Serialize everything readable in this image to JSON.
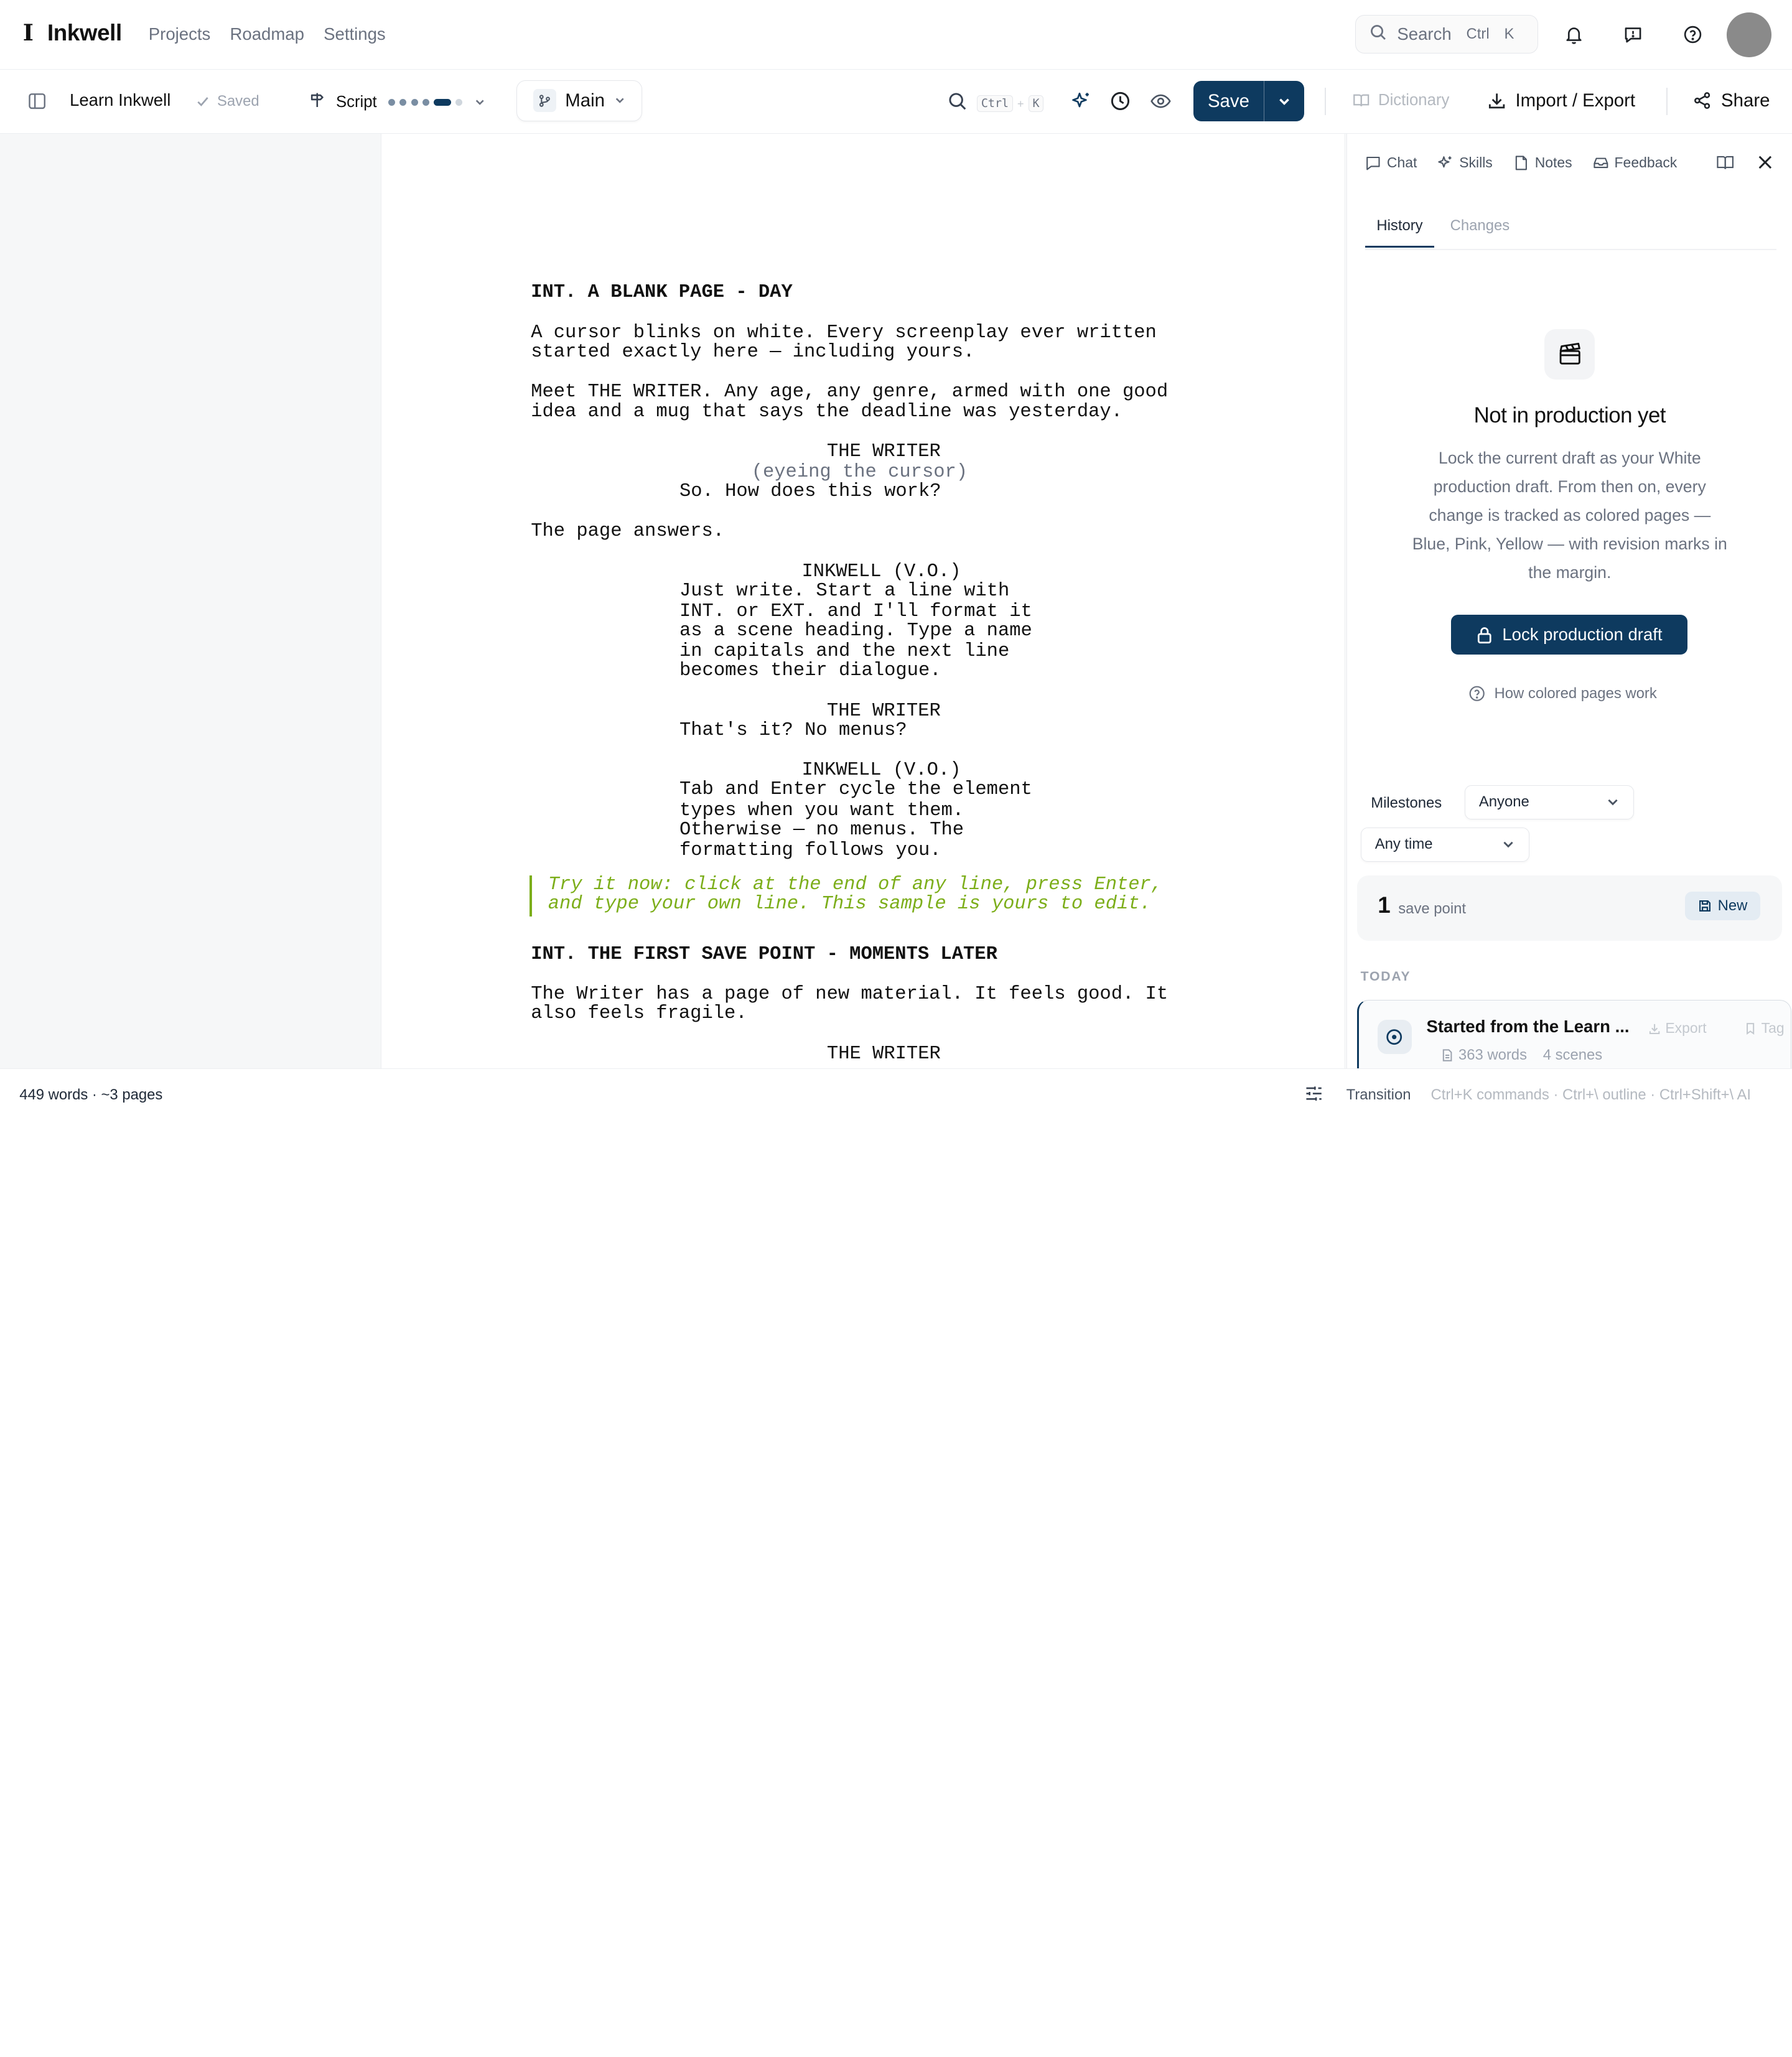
{
  "app": {
    "logo_mark": "I",
    "name": "Inkwell",
    "nav": [
      "Projects",
      "Roadmap",
      "Settings"
    ],
    "search": {
      "label": "Search",
      "shortcut_mod": "Ctrl",
      "shortcut_key": "K"
    }
  },
  "toolbar": {
    "doc_title": "Learn Inkwell",
    "saved_status": "Saved",
    "mode": "Script",
    "branch": "Main",
    "find_kbd_mod": "Ctrl",
    "find_kbd_plus": "+",
    "find_kbd_key": "K",
    "save": "Save",
    "dictionary": "Dictionary",
    "import_export": "Import / Export",
    "share": "Share"
  },
  "script": {
    "h1": "INT. A BLANK PAGE - DAY",
    "a1_l1": "A cursor blinks on white. Every screenplay ever written",
    "a1_l2": "started exactly here — including yours.",
    "a2_l1": "Meet THE WRITER. Any age, any genre, armed with one good",
    "a2_l2": "idea and a mug that says the deadline was yesterday.",
    "c1": "THE WRITER",
    "p1": "(eyeing the cursor)",
    "d1": "So. How does this work?",
    "a3": "The page answers.",
    "c2": "INKWELL (V.O.)",
    "d2_l1": "Just write. Start a line with",
    "d2_l2": "INT. or EXT. and I'll format it",
    "d2_l3": "as a scene heading. Type a name",
    "d2_l4": "in capitals and the next line",
    "d2_l5": "becomes their dialogue.",
    "c3": "THE WRITER",
    "d3": "That's it? No menus?",
    "c4": "INKWELL (V.O.)",
    "d4_l1": "Tab and Enter cycle the element",
    "d4_l2": "types when you want them.",
    "d4_l3": "Otherwise — no menus. The",
    "d4_l4": "formatting follows you.",
    "tip_l1": "Try it now: click at the end of any line, press Enter,",
    "tip_l2": "and type your own line. This sample is yours to edit.",
    "h2": "INT. THE FIRST SAVE POINT - MOMENTS LATER",
    "a4_l1": "The Writer has a page of new material. It feels good. It",
    "a4_l2": "also feels fragile.",
    "c5": "THE WRITER"
  },
  "panel": {
    "tabs": [
      "Chat",
      "Skills",
      "Notes",
      "Feedback"
    ],
    "subtabs": [
      "History",
      "Changes"
    ],
    "empty_title": "Not in production yet",
    "empty_body": "Lock the current draft as your White production draft. From then on, every change is tracked as colored pages — Blue, Pink, Yellow — with revision marks in the margin.",
    "lock_button": "Lock production draft",
    "help_link": "How colored pages work",
    "milestones_label": "Milestones",
    "author_filter": "Anyone",
    "time_filter": "Any time",
    "save_count": "1",
    "save_label": "save point",
    "new_button": "New",
    "today_label": "TODAY",
    "entry": {
      "title": "Started from the Learn ...",
      "export": "Export",
      "tag": "Tag",
      "words": "363 words",
      "scenes": "4 scenes"
    }
  },
  "status": {
    "counts": "449 words · ~3 pages",
    "element": "Transition",
    "hints": "Ctrl+K commands · Ctrl+\\ outline · Ctrl+Shift+\\ AI"
  },
  "colors": {
    "accent": "#0e3a5f",
    "tip": "#7cae1a"
  }
}
